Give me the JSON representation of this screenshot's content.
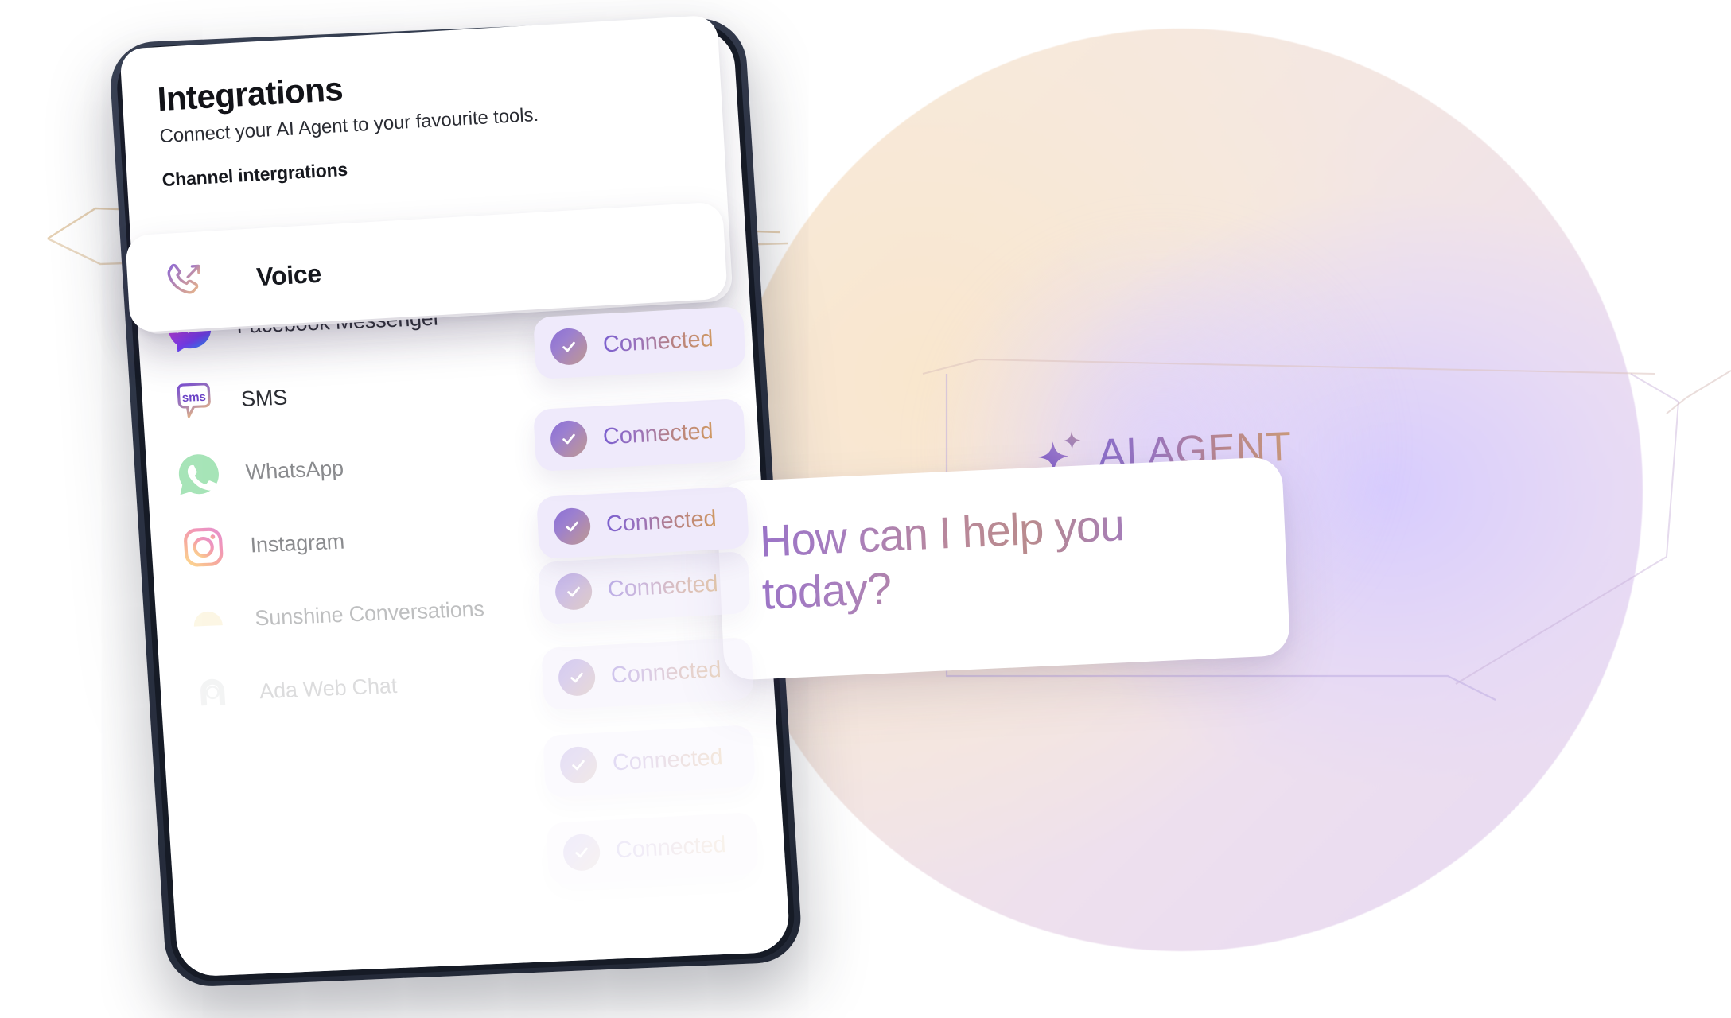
{
  "panel": {
    "title": "Integrations",
    "subtitle": "Connect your AI Agent to your favourite tools.",
    "section_label": "Channel intergrations",
    "featured": {
      "name": "Voice",
      "icon": "outgoing-call-icon",
      "status": "Connected"
    },
    "integrations": [
      {
        "name": "Facebook Messenger",
        "icon": "facebook-messenger-icon",
        "status": "Connected"
      },
      {
        "name": "SMS",
        "icon": "sms-icon",
        "status": "Connected"
      },
      {
        "name": "WhatsApp",
        "icon": "whatsapp-icon",
        "status": "Connected"
      },
      {
        "name": "Instagram",
        "icon": "instagram-icon",
        "status": "Connected"
      },
      {
        "name": "Sunshine Conversations",
        "icon": "sunshine-conversations-icon",
        "status": "Connected"
      },
      {
        "name": "Ada Web Chat",
        "icon": "ada-web-chat-icon",
        "status": "Connected"
      }
    ]
  },
  "agent": {
    "badge_label": "AI AGENT",
    "sparkle_icon": "sparkles-icon",
    "greeting_line_1": "How can I help you",
    "greeting_line_2": "today?"
  },
  "colors": {
    "accent_purple": "#8a6ec9",
    "accent_peach": "#d09a62",
    "badge_bg": "#efeafb",
    "whatsapp_green": "#5fce7e",
    "instagram_pink": "#e8437d",
    "instagram_orange": "#f5a councils",
    "sunshine_yellow": "#f6e3a8",
    "text_dark": "#16181e"
  }
}
